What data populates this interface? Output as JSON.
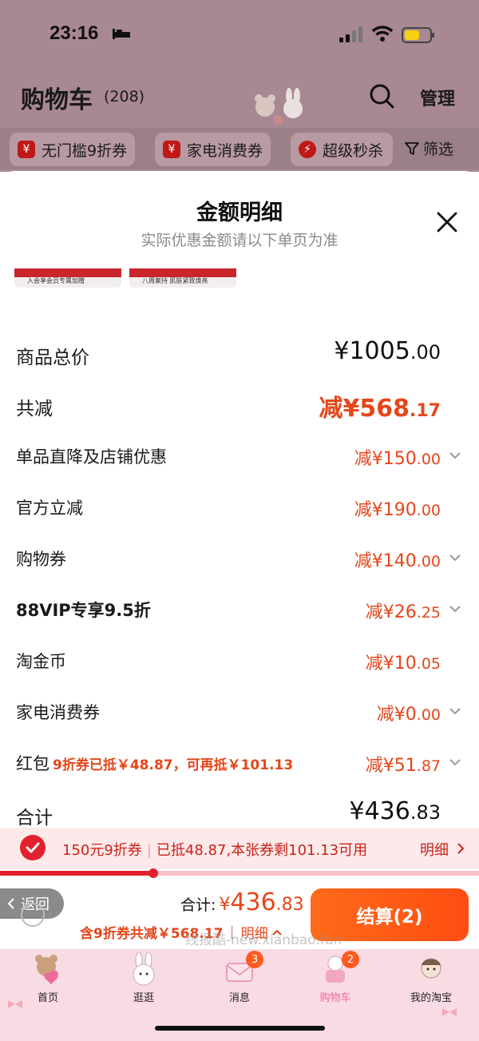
{
  "status_bar": {
    "time": "23:16"
  },
  "header": {
    "title": "购物车",
    "count": "(208)",
    "manage": "管理"
  },
  "filters": [
    {
      "label": "无门槛9折券",
      "icon": "yen-coupon-icon",
      "icon_glyph": "¥"
    },
    {
      "label": "家电消费券",
      "icon": "yen-coupon-icon",
      "icon_glyph": "¥"
    },
    {
      "label": "超级秒杀",
      "icon": "flash-icon",
      "icon_glyph": "⚡"
    }
  ],
  "filter_button": "筛选",
  "sheet": {
    "title": "金额明细",
    "subtitle": "实际优惠金额请以下单页为准",
    "banners": [
      "入会享会员专属加赠",
      "八周案持 肌肤紧致焕亮"
    ]
  },
  "rows": {
    "total_price": {
      "label": "商品总价",
      "prefix": "¥",
      "int": "1005",
      "dec": ".00"
    },
    "total_reduce": {
      "label": "共减",
      "prefix": "减¥",
      "int": "568",
      "dec": ".17"
    },
    "store_discount": {
      "label": "单品直降及店铺优惠",
      "prefix": "减¥",
      "int": "150",
      "dec": ".00"
    },
    "official_discount": {
      "label": "官方立减",
      "prefix": "减¥",
      "int": "190",
      "dec": ".00"
    },
    "shopping_coupon": {
      "label": "购物券",
      "prefix": "减¥",
      "int": "140",
      "dec": ".00"
    },
    "vip_discount": {
      "label": "88VIP专享9.5折",
      "prefix": "减¥",
      "int": "26",
      "dec": ".25"
    },
    "taojinbi": {
      "label": "淘金币",
      "prefix": "减¥",
      "int": "10",
      "dec": ".05"
    },
    "appliance_coupon": {
      "label": "家电消费券",
      "prefix": "减¥",
      "int": "0",
      "dec": ".00"
    },
    "red_packet": {
      "label": "红包",
      "note": "9折券已抵￥48.87，可再抵￥101.13",
      "prefix": "减¥",
      "int": "51",
      "dec": ".87"
    },
    "sum": {
      "label": "合计",
      "prefix": "¥",
      "int": "436",
      "dec": ".83"
    }
  },
  "coupon_strip": {
    "name": "150元9折券",
    "status": "已抵48.87,本张券剩101.13可用",
    "detail": "明细",
    "progress": 0.32
  },
  "bottom": {
    "back": "返回",
    "total_label": "合计:",
    "total_yen": "¥",
    "total_int": "436",
    "total_dec": ".83",
    "discount_text": "含9折券共减￥568.17",
    "detail": "明细",
    "checkout": "结算(2)",
    "watermark": "线报酷-new.xianbao.fun"
  },
  "tabs": [
    {
      "label": "首页",
      "icon": "home-bear-icon"
    },
    {
      "label": "逛逛",
      "icon": "bunny-icon"
    },
    {
      "label": "消息",
      "icon": "message-icon",
      "badge": "3"
    },
    {
      "label": "购物车",
      "icon": "cart-icon",
      "badge": "2"
    },
    {
      "label": "我的淘宝",
      "icon": "profile-icon"
    }
  ],
  "colors": {
    "accent": "#e5461a",
    "checkout": "#ff5a1a",
    "strip_bg": "#fde9ea",
    "tabbar_bg": "#f9dbe3"
  }
}
